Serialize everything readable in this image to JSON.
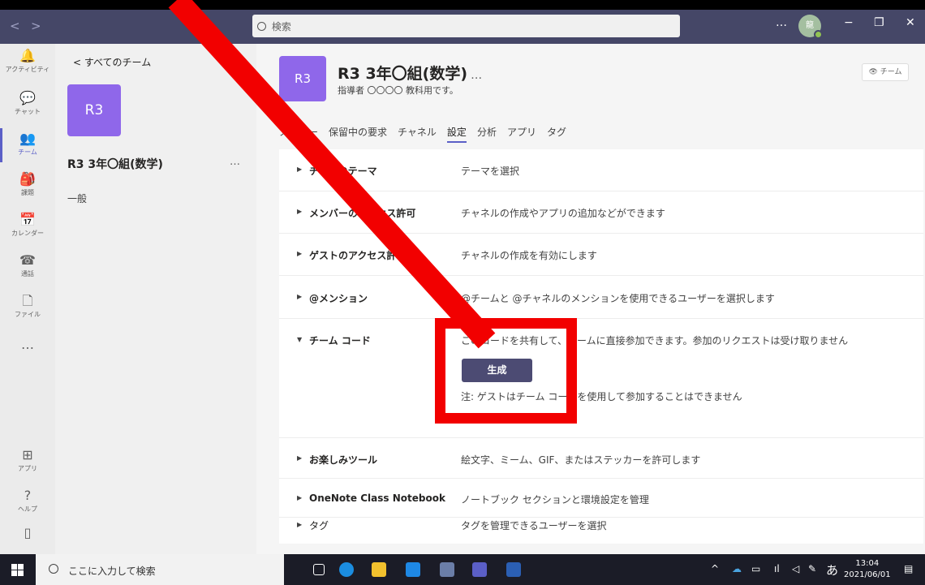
{
  "titlebar": {
    "search_placeholder": "検索",
    "more": "…",
    "avatar": "龍",
    "minimize": "−",
    "maximize": "❐",
    "close": "✕",
    "back": "<",
    "forward": ">"
  },
  "appbar": {
    "items": [
      {
        "label": "アクティビティ",
        "icon": "bell-icon",
        "glyph": "🔔"
      },
      {
        "label": "チャット",
        "icon": "chat-icon",
        "glyph": "💬"
      },
      {
        "label": "チーム",
        "icon": "teams-icon",
        "glyph": "👥"
      },
      {
        "label": "課題",
        "icon": "assignments-icon",
        "glyph": "🎒"
      },
      {
        "label": "カレンダー",
        "icon": "calendar-icon",
        "glyph": "📅"
      },
      {
        "label": "通話",
        "icon": "phone-icon",
        "glyph": "☎"
      },
      {
        "label": "ファイル",
        "icon": "file-icon",
        "glyph": "🗋"
      },
      {
        "label": "",
        "icon": "more-icon",
        "glyph": "…"
      },
      {
        "label": "アプリ",
        "icon": "apps-icon",
        "glyph": "⊞"
      },
      {
        "label": "ヘルプ",
        "icon": "help-icon",
        "glyph": "?"
      },
      {
        "label": "",
        "icon": "device-icon",
        "glyph": "▯"
      }
    ]
  },
  "teamlist": {
    "back_label": "< すべてのチーム",
    "tile": "R3",
    "team_name": "R3 3年〇組(数学)",
    "more": "…",
    "channel": "一般"
  },
  "header": {
    "tile": "R3",
    "title": "R3 3年〇組(数学)",
    "more": "…",
    "subtitle": "指導者 〇〇〇〇 教科用です。",
    "team_badge": "👁 チーム"
  },
  "tabs": [
    "メンバー",
    "保留中の要求",
    "チャネル",
    "設定",
    "分析",
    "アプリ",
    "タグ"
  ],
  "active_tab": "設定",
  "settings": [
    {
      "title": "チームのテーマ",
      "desc": "テーマを選択",
      "expanded": false
    },
    {
      "title": "メンバーのアクセス許可",
      "desc": "チャネルの作成やアプリの追加などができます",
      "expanded": false
    },
    {
      "title": "ゲストのアクセス許可",
      "desc": "チャネルの作成を有効にします",
      "expanded": false
    },
    {
      "title": "@メンション",
      "desc": "@チームと @チャネルのメンションを使用できるユーザーを選択します",
      "expanded": false
    },
    {
      "title": "チーム コード",
      "desc": "このコードを共有して、チームに直接参加できます。参加のリクエストは受け取りません",
      "expanded": true
    },
    {
      "title": "お楽しみツール",
      "desc": "絵文字、ミーム、GIF、またはステッカーを許可します",
      "expanded": false
    },
    {
      "title": "OneNote Class Notebook",
      "desc": "ノートブック セクションと環境設定を管理",
      "expanded": false
    },
    {
      "title": "タグ",
      "desc": "タグを管理できるユーザーを選択",
      "expanded": false
    }
  ],
  "team_code": {
    "button": "生成",
    "note": "注: ゲストはチーム コードを使用して参加することはできません"
  },
  "taskbar": {
    "search_placeholder": "ここに入力して検索",
    "time": "13:04",
    "date": "2021/06/01",
    "ime": "あ",
    "tray_icons": [
      "chevron-up-icon",
      "onedrive-icon",
      "battery-icon",
      "network-icon",
      "volume-icon",
      "pen-icon"
    ]
  },
  "colors": {
    "accent": "#5b5fc7",
    "team_tile": "#8f67ea",
    "title_strip": "#454767",
    "annotation": "#f20000"
  }
}
